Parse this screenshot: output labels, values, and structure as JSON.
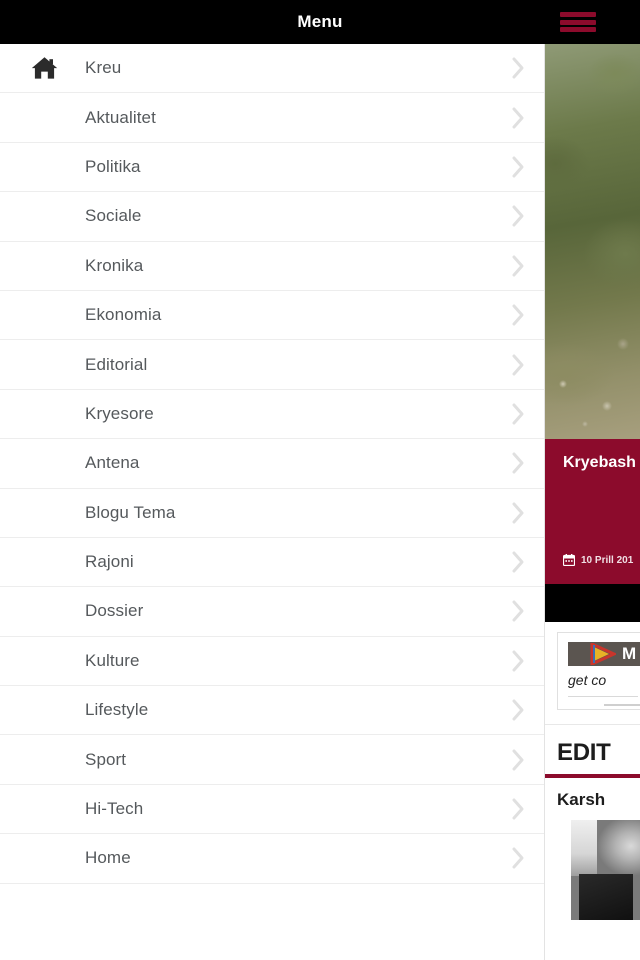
{
  "header": {
    "title": "Menu",
    "hamburger_icon": "hamburger-menu-icon",
    "background_color": "#000000",
    "hamburger_color": "#8c0b2c",
    "title_color": "#ffffff"
  },
  "menu": {
    "items": [
      {
        "label": "Kreu",
        "icon": "home-icon",
        "has_icon": true,
        "chevron": "chevron-right-icon"
      },
      {
        "label": "Aktualitet",
        "icon": "",
        "has_icon": false,
        "chevron": "chevron-right-icon"
      },
      {
        "label": "Politika",
        "icon": "",
        "has_icon": false,
        "chevron": "chevron-right-icon"
      },
      {
        "label": "Sociale",
        "icon": "",
        "has_icon": false,
        "chevron": "chevron-right-icon"
      },
      {
        "label": "Kronika",
        "icon": "",
        "has_icon": false,
        "chevron": "chevron-right-icon"
      },
      {
        "label": "Ekonomia",
        "icon": "",
        "has_icon": false,
        "chevron": "chevron-right-icon"
      },
      {
        "label": "Editorial",
        "icon": "",
        "has_icon": false,
        "chevron": "chevron-right-icon"
      },
      {
        "label": "Kryesore",
        "icon": "",
        "has_icon": false,
        "chevron": "chevron-right-icon"
      },
      {
        "label": "Antena",
        "icon": "",
        "has_icon": false,
        "chevron": "chevron-right-icon"
      },
      {
        "label": "Blogu Tema",
        "icon": "",
        "has_icon": false,
        "chevron": "chevron-right-icon"
      },
      {
        "label": "Rajoni",
        "icon": "",
        "has_icon": false,
        "chevron": "chevron-right-icon"
      },
      {
        "label": "Dossier",
        "icon": "",
        "has_icon": false,
        "chevron": "chevron-right-icon"
      },
      {
        "label": "Kulture",
        "icon": "",
        "has_icon": false,
        "chevron": "chevron-right-icon"
      },
      {
        "label": "Lifestyle",
        "icon": "",
        "has_icon": false,
        "chevron": "chevron-right-icon"
      },
      {
        "label": "Sport",
        "icon": "",
        "has_icon": false,
        "chevron": "chevron-right-icon"
      },
      {
        "label": "Hi-Tech",
        "icon": "",
        "has_icon": false,
        "chevron": "chevron-right-icon"
      },
      {
        "label": "Home",
        "icon": "",
        "has_icon": false,
        "chevron": "chevron-right-icon"
      }
    ],
    "text_color": "#55595c",
    "background_color": "#ffffff",
    "separator_color": "#ededed"
  },
  "content": {
    "hero": {
      "photo_alt": "green-hillside-dirt-path-photo",
      "card_color": "#8c0b2c",
      "title": "Kryebash",
      "date_icon": "calendar-icon",
      "date": "10 Prill 201"
    },
    "ad": {
      "logo_icon": "play-triangle-icon",
      "brand": "M",
      "tagline": "get co"
    },
    "editorial": {
      "heading": "EDIT",
      "accent_color": "#8c0b2c",
      "article_title": "Karsh",
      "article_photo_alt": "black-and-white-portrait-of-man-in-suit"
    }
  }
}
